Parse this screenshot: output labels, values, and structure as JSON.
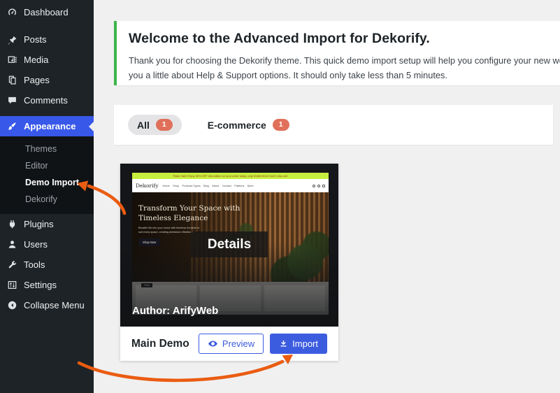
{
  "sidebar": {
    "items_top": [
      {
        "label": "Dashboard"
      },
      {
        "label": "Posts"
      },
      {
        "label": "Media"
      },
      {
        "label": "Pages"
      },
      {
        "label": "Comments"
      },
      {
        "label": "Appearance"
      }
    ],
    "appearance_submenu": [
      {
        "label": "Themes"
      },
      {
        "label": "Editor"
      },
      {
        "label": "Demo Import",
        "current": true
      },
      {
        "label": "Dekorify"
      }
    ],
    "items_bottom": [
      {
        "label": "Plugins"
      },
      {
        "label": "Users"
      },
      {
        "label": "Tools"
      },
      {
        "label": "Settings"
      },
      {
        "label": "Collapse Menu"
      }
    ]
  },
  "welcome": {
    "heading": "Welcome to the Advanced Import for Dekorify.",
    "body_line1": "Thank you for choosing the Dekorify theme. This quick demo import setup will help you configure your new website like",
    "body_line2": "you a little about Help & Support options. It should only take less than 5 minutes."
  },
  "filters": {
    "tabs": [
      {
        "label": "All",
        "count": "1",
        "selected": true
      },
      {
        "label": "E-commerce",
        "count": "1",
        "selected": false
      }
    ]
  },
  "demo_card": {
    "title": "Main Demo",
    "author": "Author: ArifyWeb",
    "details_label": "Details",
    "preview_button": "Preview",
    "import_button": "Import",
    "site_preview": {
      "banner": "Flash Sale! Enjoy 30% OFF decoration on your order today, only limited time! Don't miss out!",
      "logo": "Dekorify",
      "nav": [
        "Home",
        "Shop",
        "Products Types",
        "Blog",
        "About",
        "Contact",
        "Patterns",
        "More"
      ],
      "hero_title_line1": "Transform Your Space with",
      "hero_title_line2": "Timeless Elegance",
      "hero_text": "Breathe life into your home with timeless furniture to suit every space, creating ambiance effortlessly.",
      "hero_button": "Shop Now",
      "product_tag": "Chair"
    }
  },
  "colors": {
    "sidebar_dark": "#1d2327",
    "submenu_dark": "#101316",
    "selected_menu_blue": "#3858e9",
    "accent_blue": "#3c5ce0",
    "success_green": "#3db54c",
    "badge_coral": "#e0705a",
    "arrow_orange": "#ea5c11",
    "banner_lime": "#c6ee3e",
    "content_bg": "#f0f0f1"
  }
}
